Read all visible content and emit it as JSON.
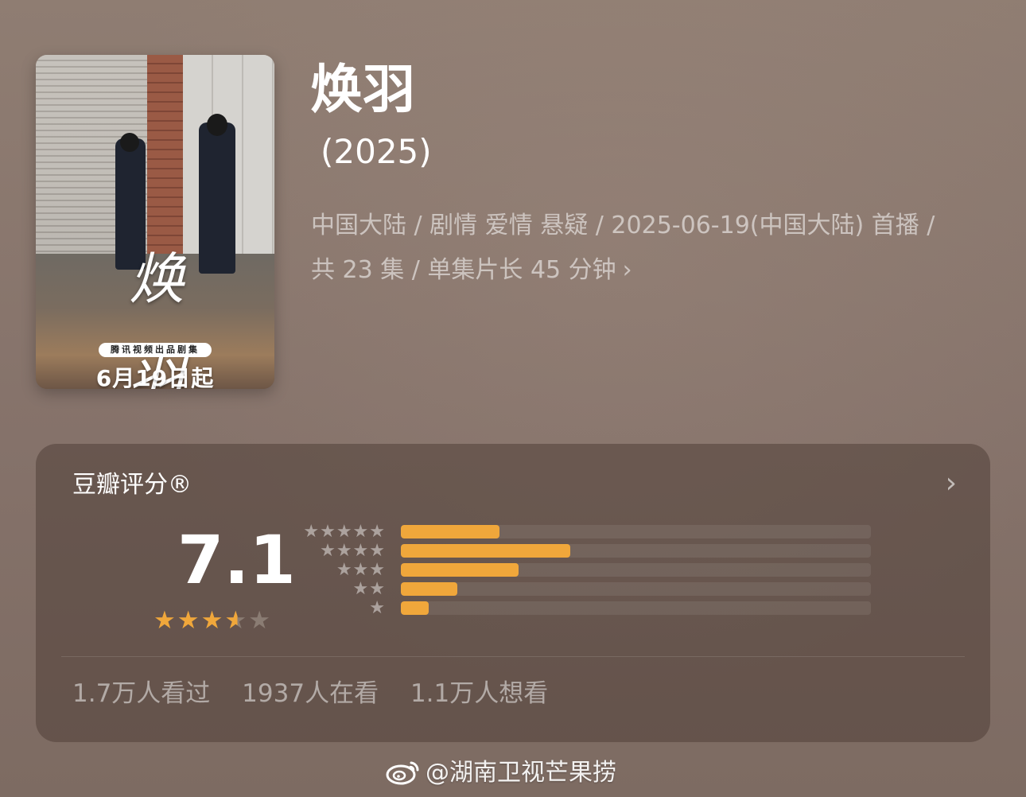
{
  "poster": {
    "calligraphy": "焕羽",
    "badge": "腾讯视频出品剧集",
    "release": "6月19日起"
  },
  "show": {
    "title": "焕羽",
    "year": "(2025)",
    "meta_line1": "中国大陆 / 剧情 爱情 悬疑 / 2025-06-19(中国大陆) 首播 /",
    "meta_line2": "共 23 集 / 单集片长 45 分钟",
    "chevron": "›"
  },
  "rating": {
    "title": "豆瓣评分®",
    "chevron": "›",
    "score": "7.1",
    "star_rating": 3.5,
    "star_max": 5,
    "distribution": [
      {
        "stars": "★★★★★",
        "fraction": 0.21
      },
      {
        "stars": "★★★★",
        "fraction": 0.36
      },
      {
        "stars": "★★★",
        "fraction": 0.25
      },
      {
        "stars": "★★",
        "fraction": 0.12
      },
      {
        "stars": "★",
        "fraction": 0.06
      }
    ],
    "counts": {
      "watched": "1.7万人看过",
      "watching": "1937人在看",
      "want": "1.1万人想看"
    }
  },
  "watermark": {
    "icon": "weibo-icon",
    "text": "@湖南卫视芒果捞"
  },
  "colors": {
    "accent": "#f0a73b",
    "background": "#8c7a6f",
    "card": "#5a4a42"
  }
}
